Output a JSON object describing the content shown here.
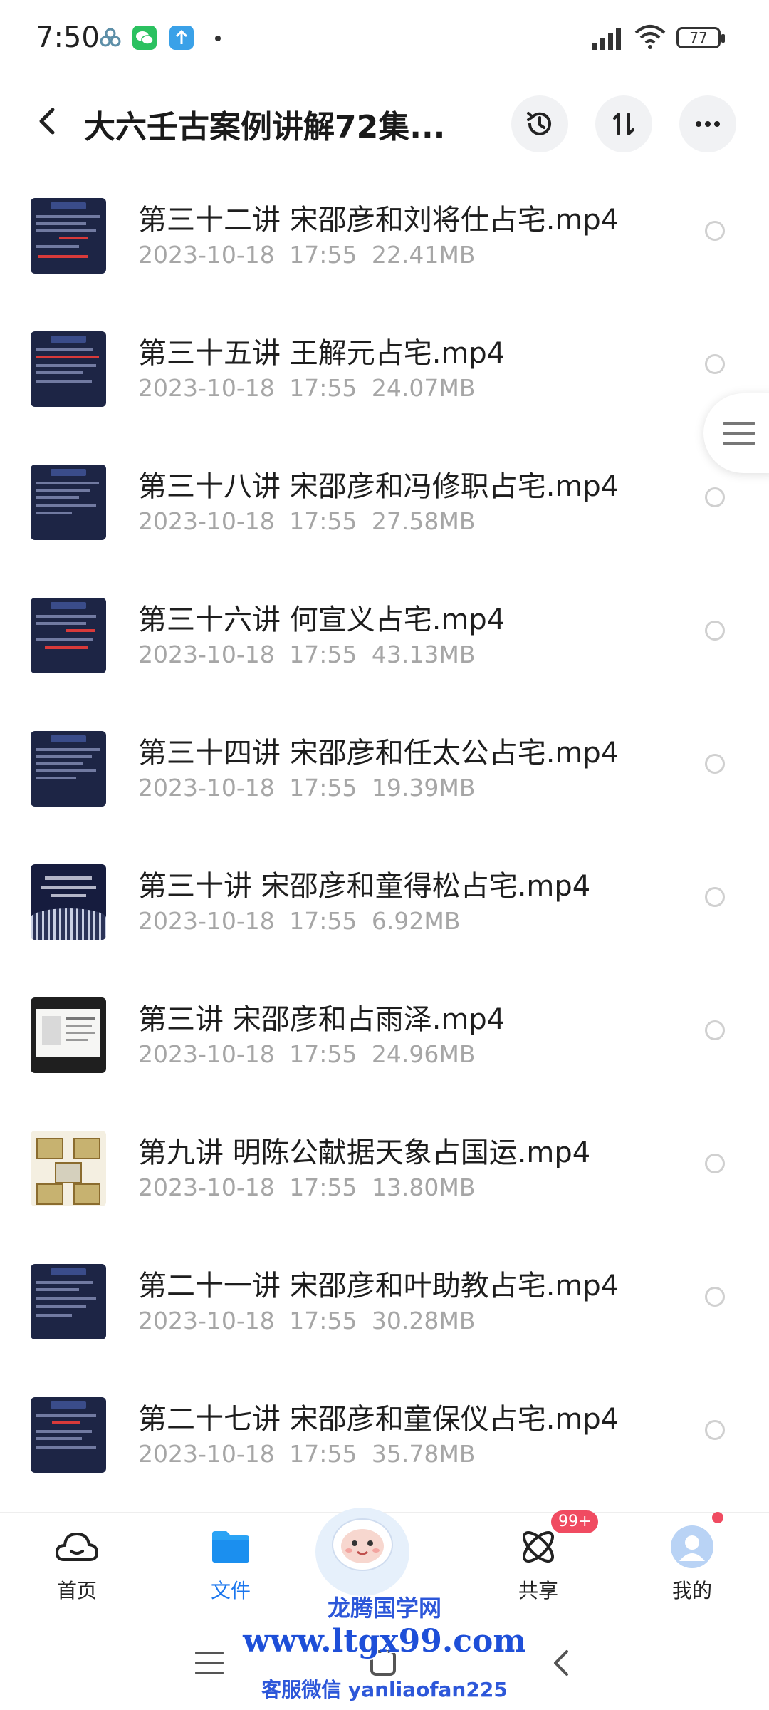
{
  "status_bar": {
    "time": "7:50",
    "battery": "77",
    "icons": [
      "meeting-icon",
      "wechat-icon",
      "upload-icon",
      "signal-icon",
      "wifi-icon",
      "battery-icon"
    ]
  },
  "header": {
    "title": "大六壬古案例讲解72集...",
    "icons": [
      "back-icon",
      "history-icon",
      "sort-icon",
      "more-icon"
    ]
  },
  "files": [
    {
      "name": "第三十二讲 宋邵彦和刘将仕占宅.mp4",
      "date": "2023-10-18",
      "time": "17:55",
      "size": "22.41MB",
      "thumb": "dark"
    },
    {
      "name": "第三十五讲 王解元占宅.mp4",
      "date": "2023-10-18",
      "time": "17:55",
      "size": "24.07MB",
      "thumb": "dark"
    },
    {
      "name": "第三十八讲 宋邵彦和冯修职占宅.mp4",
      "date": "2023-10-18",
      "time": "17:55",
      "size": "27.58MB",
      "thumb": "dark"
    },
    {
      "name": "第三十六讲 何宣义占宅.mp4",
      "date": "2023-10-18",
      "time": "17:55",
      "size": "43.13MB",
      "thumb": "dark"
    },
    {
      "name": "第三十四讲 宋邵彦和任太公占宅.mp4",
      "date": "2023-10-18",
      "time": "17:55",
      "size": "19.39MB",
      "thumb": "dark"
    },
    {
      "name": "第三十讲 宋邵彦和童得松占宅.mp4",
      "date": "2023-10-18",
      "time": "17:55",
      "size": "6.92MB",
      "thumb": "roof"
    },
    {
      "name": "第三讲 宋邵彦和占雨泽.mp4",
      "date": "2023-10-18",
      "time": "17:55",
      "size": "24.96MB",
      "thumb": "ppt"
    },
    {
      "name": "第九讲 明陈公献据天象占国运.mp4",
      "date": "2023-10-18",
      "time": "17:55",
      "size": "13.80MB",
      "thumb": "light"
    },
    {
      "name": "第二十一讲 宋邵彦和叶助教占宅.mp4",
      "date": "2023-10-18",
      "time": "17:55",
      "size": "30.28MB",
      "thumb": "dark"
    },
    {
      "name": "第二十七讲 宋邵彦和童保仪占宅.mp4",
      "date": "2023-10-18",
      "time": "17:55",
      "size": "35.78MB",
      "thumb": "dark"
    }
  ],
  "bottom_nav": {
    "items": [
      {
        "label": "首页",
        "icon": "cloud-home-icon",
        "active": false
      },
      {
        "label": "文件",
        "icon": "folder-icon",
        "active": true
      },
      {
        "label": "共享",
        "icon": "atom-share-icon",
        "active": false,
        "badge": "99+"
      },
      {
        "label": "我的",
        "icon": "avatar-icon",
        "active": false
      }
    ]
  },
  "watermark": {
    "line1": "龙腾国学网",
    "line2": "www.ltgx99.com",
    "line3": "客服微信 yanliaofan225"
  },
  "colors": {
    "accent": "#1a76ee",
    "badge": "#f04b61",
    "meta_text": "#a6a6a6",
    "watermark": "#2d57d9"
  }
}
